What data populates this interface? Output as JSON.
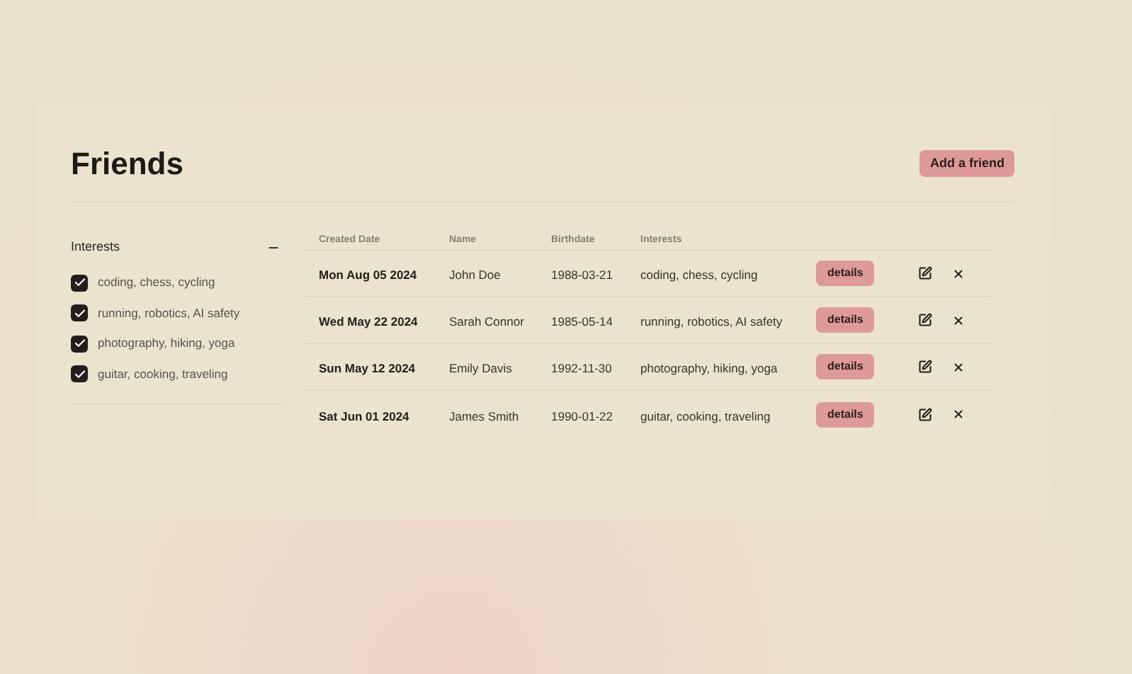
{
  "title": "Friends",
  "add_button": "Add a friend",
  "filter": {
    "label": "Interests",
    "expanded": true,
    "options": [
      {
        "label": "coding, chess, cycling",
        "checked": true
      },
      {
        "label": "running, robotics, AI safety",
        "checked": true
      },
      {
        "label": "photography, hiking, yoga",
        "checked": true
      },
      {
        "label": "guitar, cooking, traveling",
        "checked": true
      }
    ]
  },
  "table": {
    "columns": [
      "Created Date",
      "Name",
      "Birthdate",
      "Interests"
    ],
    "rows": [
      {
        "created": "Mon Aug 05 2024",
        "name": "John Doe",
        "birthdate": "1988-03-21",
        "interests": "coding, chess, cycling",
        "action": "details"
      },
      {
        "created": "Wed May 22 2024",
        "name": "Sarah Connor",
        "birthdate": "1985-05-14",
        "interests": "running, robotics, AI safety",
        "action": "details"
      },
      {
        "created": "Sun May 12 2024",
        "name": "Emily Davis",
        "birthdate": "1992-11-30",
        "interests": "photography, hiking, yoga",
        "action": "details"
      },
      {
        "created": "Sat Jun 01 2024",
        "name": "James Smith",
        "birthdate": "1990-01-22",
        "interests": "guitar, cooking, traveling",
        "action": "details"
      }
    ]
  }
}
